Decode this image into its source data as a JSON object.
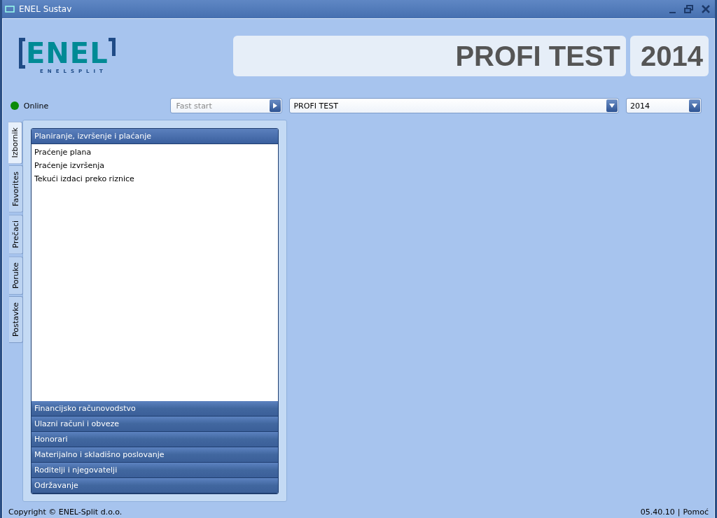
{
  "window": {
    "title": "ENEL Sustav"
  },
  "logo": {
    "mark": "ENEL",
    "subtitle": "ENELSPLIT"
  },
  "banner": {
    "title": "PROFI TEST",
    "year": "2014"
  },
  "status": {
    "label": "Online",
    "online": true
  },
  "fast_start": {
    "placeholder": "Fast start"
  },
  "company_select": {
    "value": "PROFI TEST"
  },
  "year_select": {
    "value": "2014"
  },
  "tabs": [
    {
      "label": "Izbornik",
      "selected": true
    },
    {
      "label": "Favorites",
      "selected": false
    },
    {
      "label": "Prečaci",
      "selected": false
    },
    {
      "label": "Poruke",
      "selected": false
    },
    {
      "label": "Postavke",
      "selected": false
    }
  ],
  "menu_sections": [
    {
      "title": "Planiranje, izvršenje i plaćanje",
      "expanded": true,
      "items": [
        "Praćenje plana",
        "Praćenje izvršenja",
        "Tekući izdaci preko riznice"
      ]
    },
    {
      "title": "Financijsko računovodstvo",
      "expanded": false
    },
    {
      "title": "Ulazni računi i obveze",
      "expanded": false
    },
    {
      "title": "Honorari",
      "expanded": false
    },
    {
      "title": "Materijalno i skladišno poslovanje",
      "expanded": false
    },
    {
      "title": "Roditelji i njegovatelji",
      "expanded": false
    },
    {
      "title": "Održavanje",
      "expanded": false
    }
  ],
  "footer": {
    "copyright": "Copyright © ENEL-Split d.o.o.",
    "version": "05.40.10",
    "separator": "|",
    "help": "Pomoć"
  }
}
